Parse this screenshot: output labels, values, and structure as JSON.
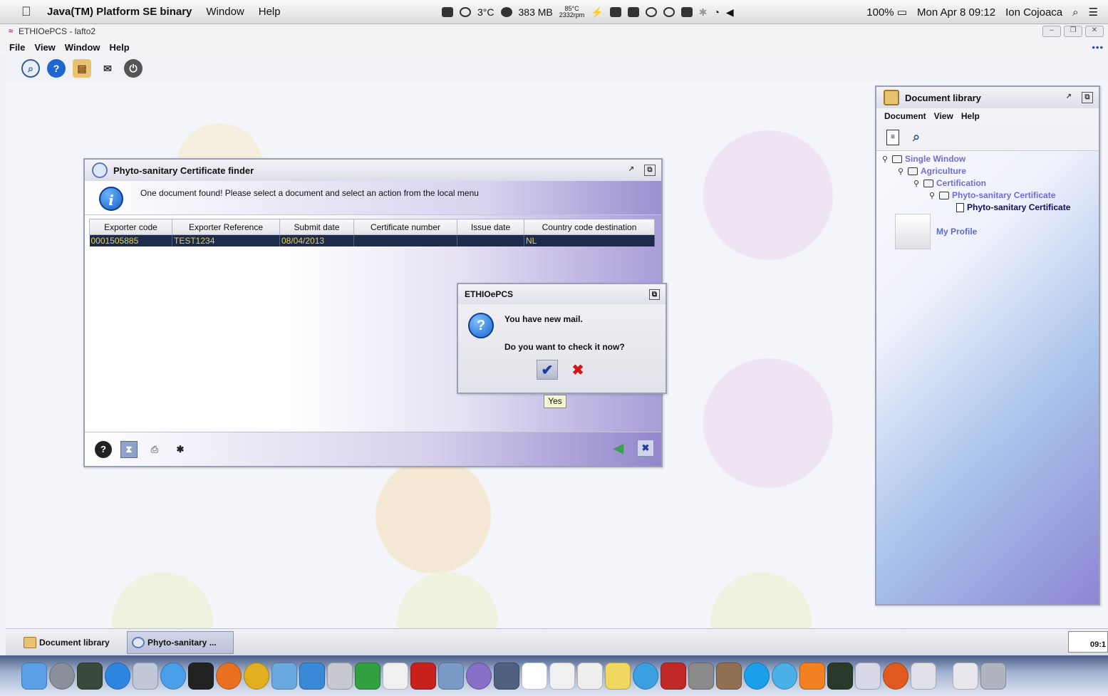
{
  "mac_menubar": {
    "app_name": "Java(TM) Platform SE binary",
    "menus": [
      "Window",
      "Help"
    ],
    "weather": "3°C",
    "memory": "383 MB",
    "cpu_temp": "85°C",
    "fan": "2332rpm",
    "battery": "100%",
    "datetime": "Mon Apr 8  09:12",
    "user": "Ion Cojoaca"
  },
  "app": {
    "title": "ETHIOePCS - lafto2",
    "menus": [
      "File",
      "View",
      "Window",
      "Help"
    ],
    "toolbar_icons": [
      "search-icon",
      "help-icon",
      "document-library-icon",
      "mail-icon",
      "power-icon"
    ],
    "more": "•••"
  },
  "finder": {
    "title": "Phyto-sanitary Certificate finder",
    "info_message": "One document found! Please select a document and select an action from the local menu",
    "columns": [
      "Exporter code",
      "Exporter Reference",
      "Submit date",
      "Certificate number",
      "Issue date",
      "Country code destination"
    ],
    "rows": [
      [
        "0001505885",
        "TEST1234",
        "08/04/2013",
        "",
        "",
        "NL"
      ]
    ],
    "bottom_icons": [
      "help-icon",
      "filter-icon",
      "print-icon",
      "bug-icon",
      "back-icon",
      "close-icon"
    ]
  },
  "dialog": {
    "title": "ETHIOePCS",
    "message1": "You have new mail.",
    "message2": "Do you want to check it now?",
    "yes_symbol": "✔",
    "no_symbol": "✖",
    "tooltip": "Yes"
  },
  "doclib": {
    "title": "Document library",
    "menus": [
      "Document",
      "View",
      "Help"
    ],
    "tree": {
      "root": "Single Window",
      "level1": "Agriculture",
      "level2": "Certification",
      "level3": "Phyto-sanitary Certificate",
      "leaf": "Phyto-sanitary Certificate"
    },
    "profile": "My Profile"
  },
  "taskbar": {
    "task1": "Document library",
    "task2": "Phyto-sanitary ...",
    "clock": "09:1"
  },
  "colors": {
    "row_bg": "#1e2a4a",
    "row_text": "#e8d048",
    "tree_link": "#6d6ddc",
    "accent": "#9386cc"
  }
}
